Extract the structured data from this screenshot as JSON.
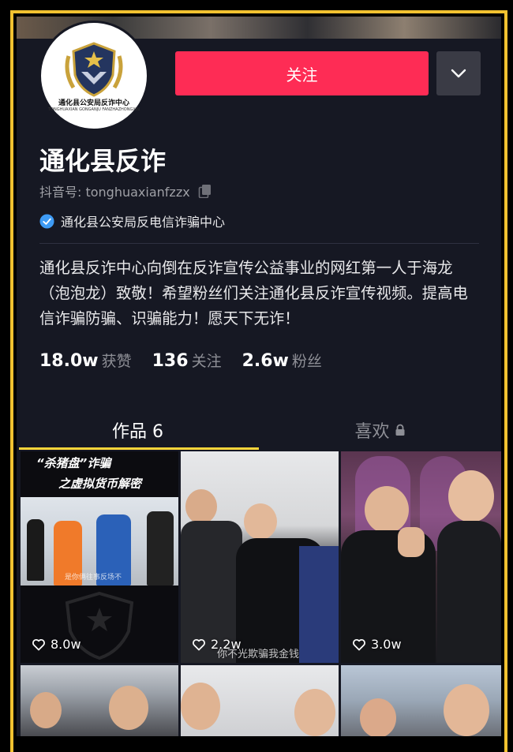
{
  "profile": {
    "avatar_text": "通化县公安局反诈中心",
    "avatar_subtext": "TONGHUAXIAN GONGANJU FANZHAZHONGXIN",
    "name": "通化县反诈",
    "douyin_id": "抖音号: tonghuaxianfzzx",
    "verified_org": "通化县公安局反电信诈骗中心",
    "bio": "通化县反诈中心向倒在反诈宣传公益事业的网红第一人于海龙（泡泡龙）致敬！希望粉丝们关注通化县反诈宣传视频。提高电信诈骗防骗、识骗能力！愿天下无诈！"
  },
  "actions": {
    "follow_label": "关注"
  },
  "stats": [
    {
      "value": "18.0w",
      "label": "获赞"
    },
    {
      "value": "136",
      "label": "关注"
    },
    {
      "value": "2.6w",
      "label": "粉丝"
    }
  ],
  "tabs": {
    "works": "作品 6",
    "likes": "喜欢"
  },
  "videos": [
    {
      "likes": "8.0w",
      "overlay_line1": "“杀猪盘”诈骗",
      "overlay_line2": "之虚拟货币解密",
      "caption": "是你俩往事反场不"
    },
    {
      "likes": "2.2w",
      "caption": "你不光欺骗我金钱"
    },
    {
      "likes": "3.0w"
    }
  ],
  "colors": {
    "background": "#161823",
    "follow_button": "#fe2c55",
    "tab_indicator": "#fdd53a",
    "frame_border": "#f2c230",
    "verified_badge": "#3e9bf5"
  }
}
